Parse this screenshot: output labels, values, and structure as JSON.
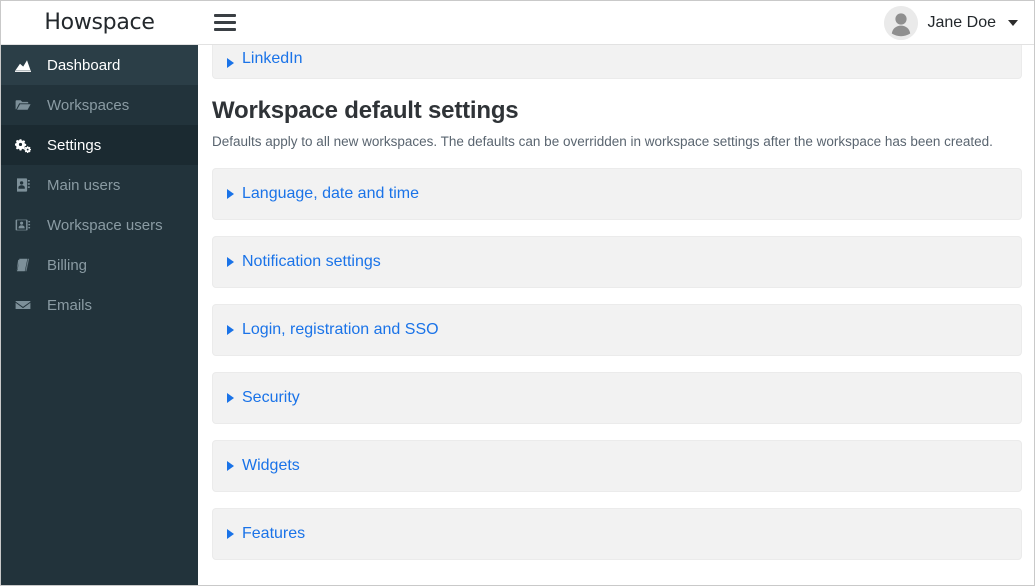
{
  "header": {
    "brand": "Howspace",
    "menu_icon": "hamburger-icon",
    "user": {
      "name": "Jane Doe",
      "avatar_icon": "user-avatar-icon",
      "caret_icon": "chevron-down-icon"
    }
  },
  "sidebar": {
    "items": [
      {
        "label": "Dashboard",
        "icon": "area-chart-icon",
        "state": "hover"
      },
      {
        "label": "Workspaces",
        "icon": "folder-open-icon",
        "state": "normal"
      },
      {
        "label": "Settings",
        "icon": "cogs-icon",
        "state": "current"
      },
      {
        "label": "Main users",
        "icon": "address-book-icon",
        "state": "normal"
      },
      {
        "label": "Workspace users",
        "icon": "address-card-icon",
        "state": "normal"
      },
      {
        "label": "Billing",
        "icon": "book-icon",
        "state": "normal"
      },
      {
        "label": "Emails",
        "icon": "envelope-icon",
        "state": "normal"
      }
    ]
  },
  "main": {
    "top_panel": {
      "title": "LinkedIn",
      "arrow_icon": "caret-right-icon"
    },
    "section_title": "Workspace default settings",
    "section_desc": "Defaults apply to all new workspaces. The defaults can be overridden in workspace settings after the workspace has been created.",
    "panels": [
      {
        "title": "Language, date and time",
        "arrow_icon": "caret-right-icon"
      },
      {
        "title": "Notification settings",
        "arrow_icon": "caret-right-icon"
      },
      {
        "title": "Login, registration and SSO",
        "arrow_icon": "caret-right-icon"
      },
      {
        "title": "Security",
        "arrow_icon": "caret-right-icon"
      },
      {
        "title": "Widgets",
        "arrow_icon": "caret-right-icon"
      },
      {
        "title": "Features",
        "arrow_icon": "caret-right-icon"
      }
    ]
  },
  "colors": {
    "sidebar_bg": "#22333b",
    "sidebar_current": "#1b2a31",
    "sidebar_hover": "#2b3e47",
    "link_blue": "#1a73e8",
    "panel_bg": "#f2f2f2",
    "text_dark": "#2f3337"
  }
}
